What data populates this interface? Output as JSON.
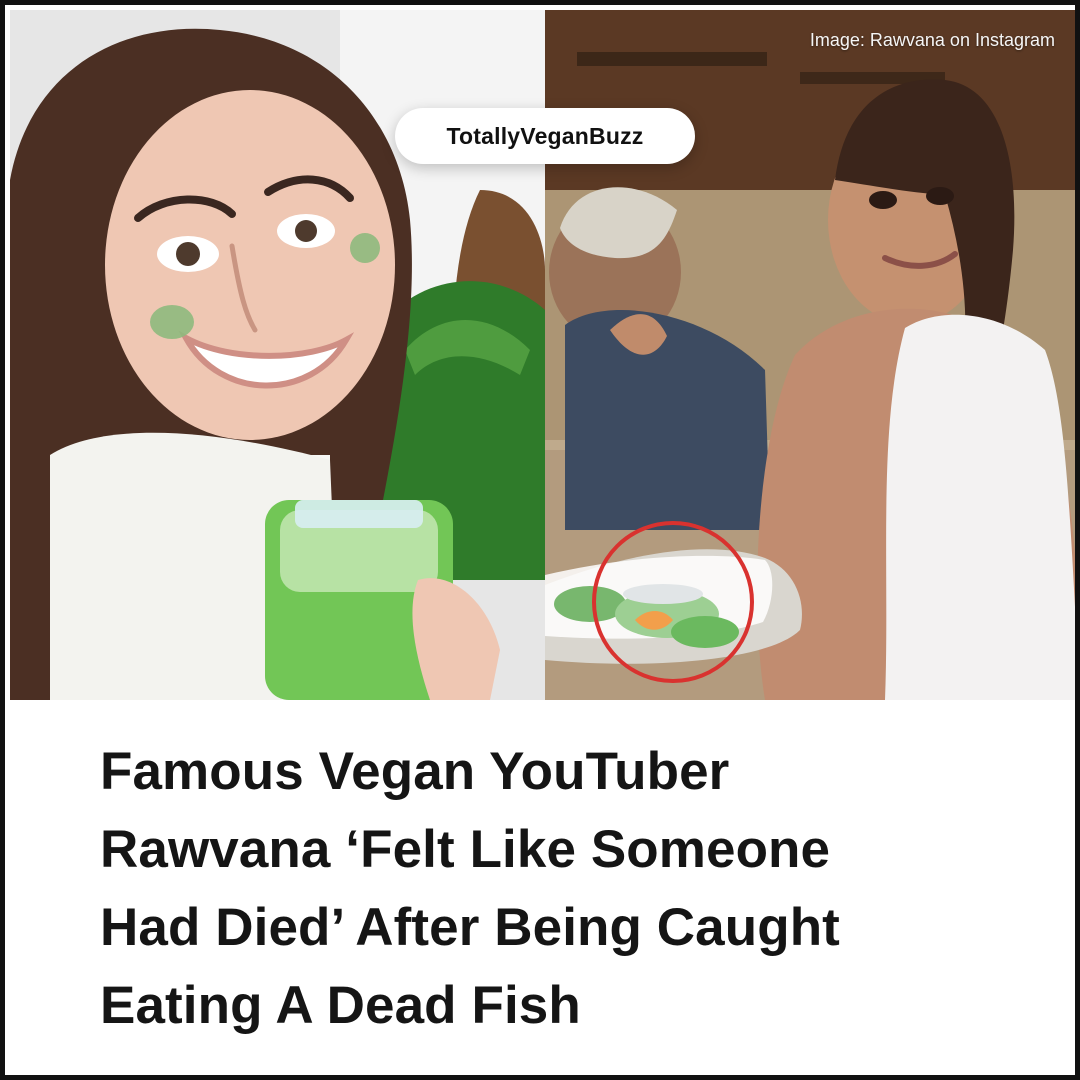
{
  "post": {
    "brand": "TotallyVeganBuzz",
    "credit": "Image: Rawvana on Instagram",
    "headline_lines": [
      "Famous Vegan YouTuber",
      "Rawvana ‘Felt Like Someone",
      "Had Died’ After Being Caught",
      "Eating A Dead Fish"
    ]
  },
  "colors": {
    "background": "#ffffff",
    "text": "#151515",
    "frame": "#111111",
    "highlight_circle": "#d9322f"
  }
}
